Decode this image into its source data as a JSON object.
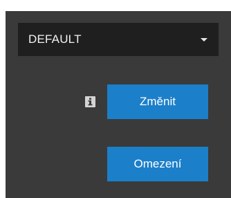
{
  "profile_select": {
    "selected_value": "DEFAULT",
    "chevron_icon": "chevron-down-icon"
  },
  "info": {
    "icon": "info-icon"
  },
  "buttons": {
    "change_label": "Změnit",
    "limits_label": "Omezení"
  },
  "colors": {
    "panel_background": "#3a3a3a",
    "select_background": "#1f1f1f",
    "button_accent": "#1c7fc9"
  }
}
